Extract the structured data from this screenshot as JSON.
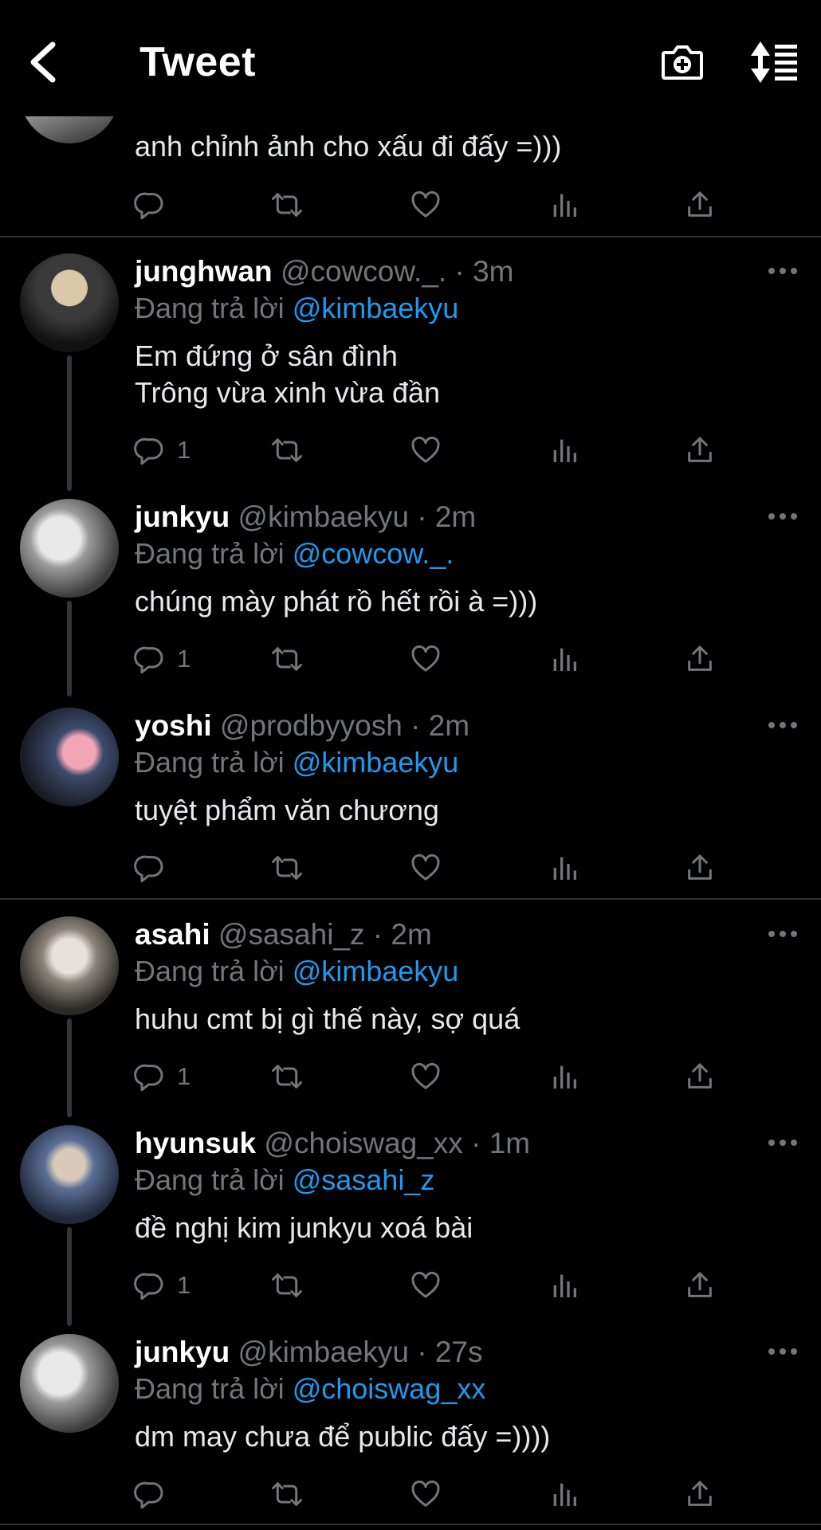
{
  "header": {
    "title": "Tweet",
    "icons": {
      "back": "chevron-left-icon",
      "camera": "camera-plus-icon",
      "sort": "sort-icon"
    }
  },
  "top_tweet": {
    "text": "anh chỉnh ảnh cho xấu đi đấy =)))"
  },
  "colors": {
    "mention": "#1d9bf0",
    "muted": "#71767b",
    "background": "#000000"
  },
  "tweets": [
    {
      "name": "junghwan",
      "handle": "@cowcow._.",
      "time": "3m",
      "reply_prefix": "Đang trả lời",
      "reply_to": "@kimbaekyu",
      "text": "Em đứng ở sân đình\nTrông vừa xinh vừa đần",
      "reply_count": "1"
    },
    {
      "name": "junkyu",
      "handle": "@kimbaekyu",
      "time": "2m",
      "reply_prefix": "Đang trả lời",
      "reply_to": "@cowcow._.",
      "text": "chúng mày phát rồ hết rồi à =)))",
      "reply_count": "1"
    },
    {
      "name": "yoshi",
      "handle": "@prodbyyosh",
      "time": "2m",
      "reply_prefix": "Đang trả lời",
      "reply_to": "@kimbaekyu",
      "text": "tuyệt phẩm văn chương",
      "reply_count": ""
    },
    {
      "name": "asahi",
      "handle": "@sasahi_z",
      "time": "2m",
      "reply_prefix": "Đang trả lời",
      "reply_to": "@kimbaekyu",
      "text": "huhu cmt bị gì thế này, sợ quá",
      "reply_count": "1"
    },
    {
      "name": "hyunsuk",
      "handle": "@choiswag_xx",
      "time": "1m",
      "reply_prefix": "Đang trả lời",
      "reply_to": "@sasahi_z",
      "text": "đề nghị kim junkyu xoá bài",
      "reply_count": "1"
    },
    {
      "name": "junkyu",
      "handle": "@kimbaekyu",
      "time": "27s",
      "reply_prefix": "Đang trả lời",
      "reply_to": "@choiswag_xx",
      "text": "dm may chưa để public đấy =))))",
      "reply_count": ""
    }
  ]
}
